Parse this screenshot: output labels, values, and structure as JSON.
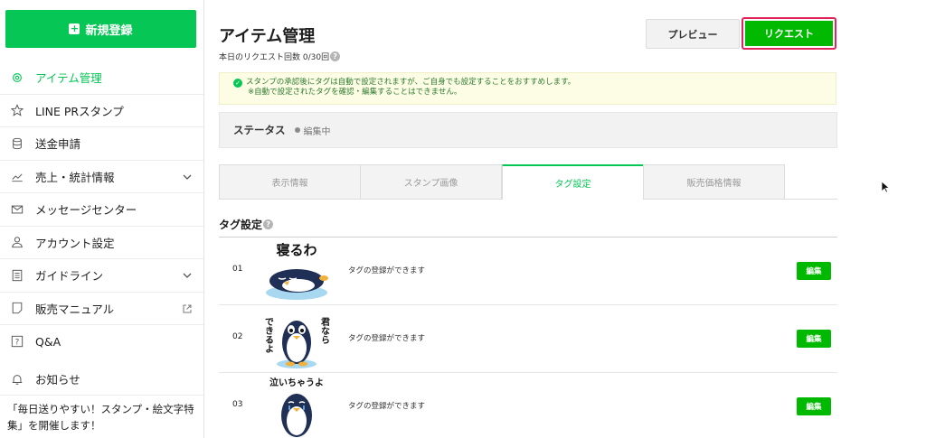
{
  "sidebar": {
    "new_button": "新規登録",
    "items": [
      {
        "label": "アイテム管理",
        "icon": "gear-icon",
        "active": true,
        "chevron": false,
        "external": false
      },
      {
        "label": "LINE PRスタンプ",
        "icon": "star-icon",
        "active": false,
        "chevron": false,
        "external": false
      },
      {
        "label": "送金申請",
        "icon": "database-icon",
        "active": false,
        "chevron": false,
        "external": false
      },
      {
        "label": "売上・統計情報",
        "icon": "chart-icon",
        "active": false,
        "chevron": true,
        "external": false
      },
      {
        "label": "メッセージセンター",
        "icon": "mail-icon",
        "active": false,
        "chevron": false,
        "external": false
      },
      {
        "label": "アカウント設定",
        "icon": "user-icon",
        "active": false,
        "chevron": false,
        "external": false
      },
      {
        "label": "ガイドライン",
        "icon": "document-icon",
        "active": false,
        "chevron": true,
        "external": false
      },
      {
        "label": "販売マニュアル",
        "icon": "note-icon",
        "active": false,
        "chevron": false,
        "external": true
      },
      {
        "label": "Q&A",
        "icon": "question-icon",
        "active": false,
        "chevron": false,
        "external": false
      }
    ],
    "notice_label": "お知らせ",
    "notice_text": "「毎日送りやすい！スタンプ・絵文字特集」を開催します！"
  },
  "header": {
    "title": "アイテム管理",
    "request_count": "本日のリクエスト回数 0/30回",
    "preview_button": "プレビュー",
    "request_button": "リクエスト"
  },
  "info": {
    "line1": "スタンプの承認後にタグは自動で設定されますが、ご自身でも設定することをおすすめします。",
    "line2": "※自動で設定されたタグを確認・編集することはできません。"
  },
  "status": {
    "label": "ステータス",
    "value": "編集中"
  },
  "tabs": [
    {
      "label": "表示情報",
      "active": false
    },
    {
      "label": "スタンプ画像",
      "active": false
    },
    {
      "label": "タグ設定",
      "active": true
    },
    {
      "label": "販売価格情報",
      "active": false
    }
  ],
  "tag_section": {
    "title": "タグ設定",
    "rows": [
      {
        "num": "01",
        "image_text": "寝るわ",
        "message": "タグの登録ができます",
        "edit": "編集"
      },
      {
        "num": "02",
        "image_text_left": "できるよ",
        "image_text_right": "君なら",
        "message": "タグの登録ができます",
        "edit": "編集"
      },
      {
        "num": "03",
        "image_text": "泣いちゃうよ",
        "message": "タグの登録ができます",
        "edit": "編集"
      }
    ]
  },
  "colors": {
    "brand_green": "#06c755",
    "button_green": "#00b900",
    "highlight_border": "#e0245e"
  }
}
